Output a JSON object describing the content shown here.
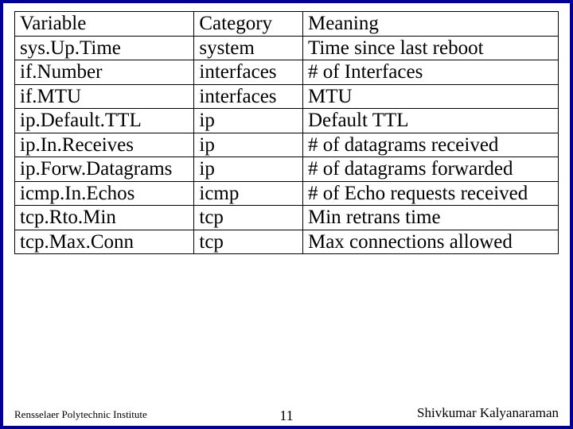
{
  "headers": {
    "c0": "Variable",
    "c1": "Category",
    "c2": "Meaning"
  },
  "rows": [
    {
      "c0": "sys.Up.Time",
      "c1": "system",
      "c2": "Time since last reboot"
    },
    {
      "c0": "if.Number",
      "c1": "interfaces",
      "c2": "# of Interfaces"
    },
    {
      "c0": "if.MTU",
      "c1": "interfaces",
      "c2": "MTU"
    },
    {
      "c0": "ip.Default.TTL",
      "c1": "ip",
      "c2": "Default TTL"
    },
    {
      "c0": "ip.In.Receives",
      "c1": "ip",
      "c2": "# of datagrams received"
    },
    {
      "c0": "ip.Forw.Datagrams",
      "c1": "ip",
      "c2": "# of datagrams forwarded"
    },
    {
      "c0": "icmp.In.Echos",
      "c1": "icmp",
      "c2": "# of Echo requests received"
    },
    {
      "c0": "tcp.Rto.Min",
      "c1": "tcp",
      "c2": "Min retrans time"
    },
    {
      "c0": "tcp.Max.Conn",
      "c1": "tcp",
      "c2": "Max connections allowed"
    }
  ],
  "footer": {
    "institute": "Rensselaer Polytechnic Institute",
    "author": "Shivkumar Kalyanaraman",
    "page": "11"
  }
}
